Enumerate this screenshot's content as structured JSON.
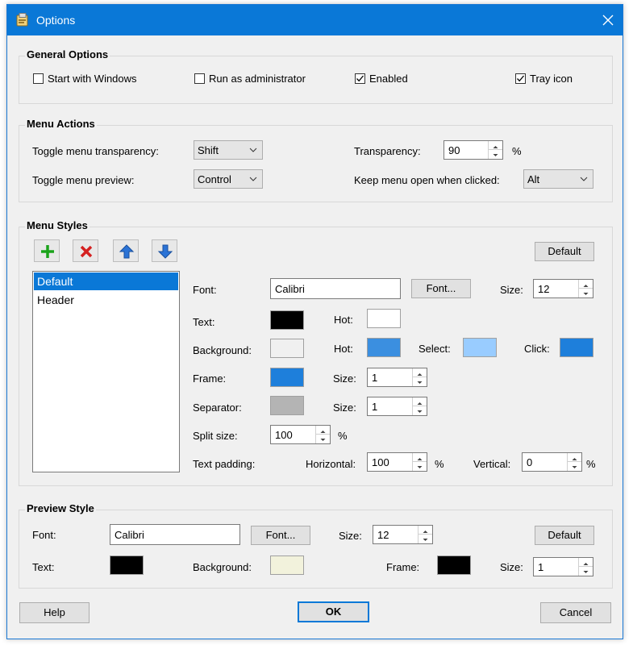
{
  "window": {
    "title": "Options"
  },
  "general": {
    "title": "General Options",
    "start_with_windows": {
      "label": "Start with Windows",
      "checked": false
    },
    "run_as_admin": {
      "label": "Run as administrator",
      "checked": false
    },
    "enabled": {
      "label": "Enabled",
      "checked": true
    },
    "tray_icon": {
      "label": "Tray icon",
      "checked": true
    }
  },
  "menu_actions": {
    "title": "Menu Actions",
    "toggle_transparency_label": "Toggle menu transparency:",
    "toggle_transparency_value": "Shift",
    "toggle_preview_label": "Toggle menu preview:",
    "toggle_preview_value": "Control",
    "transparency_label": "Transparency:",
    "transparency_value": "90",
    "transparency_unit": "%",
    "keep_open_label": "Keep menu open when clicked:",
    "keep_open_value": "Alt"
  },
  "menu_styles": {
    "title": "Menu Styles",
    "default_button": "Default",
    "list": [
      "Default",
      "Header"
    ],
    "font_label": "Font:",
    "font_value": "Calibri",
    "font_button": "Font...",
    "size_label": "Size:",
    "size_value": "12",
    "text_label": "Text:",
    "hot_label": "Hot:",
    "background_label": "Background:",
    "select_label": "Select:",
    "click_label": "Click:",
    "frame_label": "Frame:",
    "frame_size_value": "1",
    "separator_label": "Separator:",
    "separator_size_value": "1",
    "split_size_label": "Split size:",
    "split_size_value": "100",
    "percent": "%",
    "text_padding_label": "Text padding:",
    "horizontal_label": "Horizontal:",
    "horizontal_value": "100",
    "vertical_label": "Vertical:",
    "vertical_value": "0",
    "colors": {
      "text": "#000000",
      "text_hot": "#ffffff",
      "background": "#f0f0f0",
      "background_hot": "#3b8fe0",
      "select": "#99ccff",
      "click": "#1e7fdb",
      "frame": "#1e7fdb",
      "separator": "#b4b4b4"
    }
  },
  "preview_style": {
    "title": "Preview Style",
    "font_label": "Font:",
    "font_value": "Calibri",
    "font_button": "Font...",
    "size_label": "Size:",
    "size_value": "12",
    "default_button": "Default",
    "text_label": "Text:",
    "background_label": "Background:",
    "frame_label": "Frame:",
    "frame_size_label": "Size:",
    "frame_size_value": "1",
    "colors": {
      "text": "#000000",
      "background": "#f2f2dc",
      "frame": "#000000"
    }
  },
  "footer": {
    "help": "Help",
    "ok": "OK",
    "cancel": "Cancel"
  }
}
